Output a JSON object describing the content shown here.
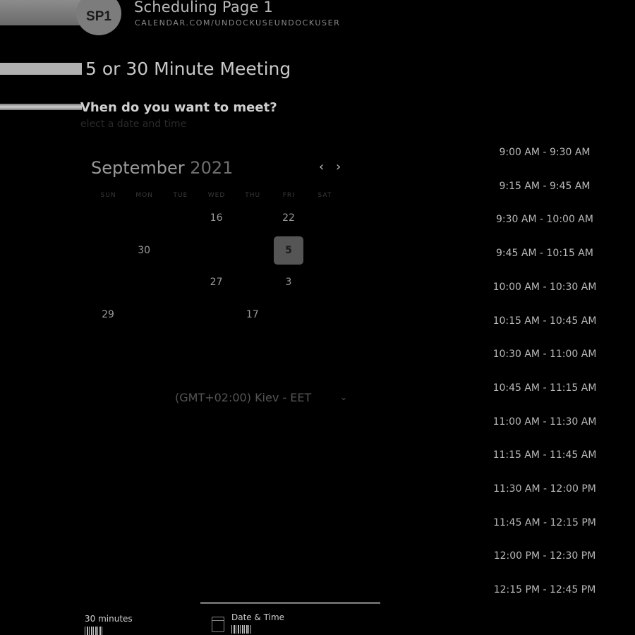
{
  "header": {
    "avatar_initials": "SP1",
    "title": "Scheduling Page 1",
    "url": "CALENDAR.COM/UNDOCKUSEUNDOCKUSER"
  },
  "event": {
    "title": "5 or 30 Minute Meeting",
    "question": "Vhen do you want to meet?",
    "subquestion": "elect a date and time"
  },
  "calendar": {
    "month": "September",
    "year": "2021",
    "prev_icon": "chevron-left-icon",
    "next_icon": "chevron-right-icon",
    "weekdays": [
      "SUN",
      "MON",
      "TUE",
      "WED",
      "THU",
      "FRI",
      "SAT"
    ],
    "days": [
      {
        "label": "16",
        "col": 3,
        "row": 0,
        "selected": false
      },
      {
        "label": "22",
        "col": 5,
        "row": 0,
        "selected": false
      },
      {
        "label": "30",
        "col": 1,
        "row": 1,
        "selected": false
      },
      {
        "label": "5",
        "col": 5,
        "row": 1,
        "selected": true
      },
      {
        "label": "27",
        "col": 3,
        "row": 2,
        "selected": false
      },
      {
        "label": "3",
        "col": 5,
        "row": 2,
        "selected": false
      },
      {
        "label": "29",
        "col": 0,
        "row": 3,
        "selected": false
      },
      {
        "label": "17",
        "col": 4,
        "row": 3,
        "selected": false
      }
    ]
  },
  "timezone": {
    "label": "(GMT+02:00) Kiev - EET",
    "icon": "chevron-down-icon"
  },
  "time_slots": [
    "9:00 AM - 9:30 AM",
    "9:15 AM - 9:45 AM",
    "9:30 AM - 10:00 AM",
    "9:45 AM - 10:15 AM",
    "10:00 AM - 10:30 AM",
    "10:15 AM - 10:45 AM",
    "10:30 AM - 11:00 AM",
    "10:45 AM - 11:15 AM",
    "11:00 AM - 11:30 AM",
    "11:15 AM - 11:45 AM",
    "11:30 AM - 12:00 PM",
    "11:45 AM - 12:15 PM",
    "12:00 PM - 12:30 PM",
    "12:15 PM - 12:45 PM"
  ],
  "footer": {
    "duration": "30 minutes",
    "date_time_label": "Date & Time",
    "calendar_icon": "calendar-icon"
  }
}
